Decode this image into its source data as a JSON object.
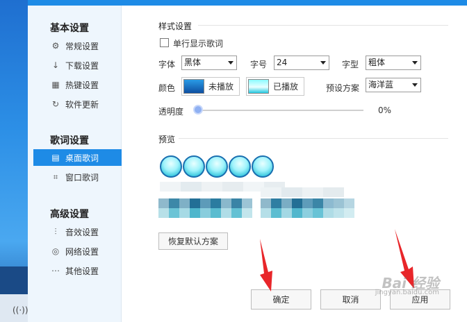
{
  "sidebar": {
    "group_basic": "基本设置",
    "basic_items": [
      {
        "label": "常规设置",
        "icon": "gear-icon",
        "glyph": "⚙"
      },
      {
        "label": "下载设置",
        "icon": "download-icon",
        "glyph": "↓"
      },
      {
        "label": "热键设置",
        "icon": "keyboard-icon",
        "glyph": "▦"
      },
      {
        "label": "软件更新",
        "icon": "refresh-icon",
        "glyph": "↻"
      }
    ],
    "group_lyrics": "歌词设置",
    "lyrics_items": [
      {
        "label": "桌面歌词",
        "icon": "desktop-lyrics-icon",
        "glyph": "▤",
        "active": true
      },
      {
        "label": "窗口歌词",
        "icon": "window-lyrics-icon",
        "glyph": "⌗",
        "active": false
      }
    ],
    "group_advanced": "高级设置",
    "advanced_items": [
      {
        "label": "音效设置",
        "icon": "equalizer-icon",
        "glyph": "⫶"
      },
      {
        "label": "网络设置",
        "icon": "network-icon",
        "glyph": "◎"
      },
      {
        "label": "其他设置",
        "icon": "more-icon",
        "glyph": "⋯"
      }
    ]
  },
  "style": {
    "title": "样式设置",
    "single_line_label": "单行显示歌词",
    "single_line_checked": false,
    "font_label": "字体",
    "font_value": "黑体",
    "size_label": "字号",
    "size_value": "24",
    "weight_label": "字型",
    "weight_value": "粗体",
    "color_label": "颜色",
    "unplayed_label": "未播放",
    "played_label": "已播放",
    "preset_label": "预设方案",
    "preset_value": "海洋蓝",
    "opacity_label": "透明度",
    "opacity_value": "0%",
    "opacity_fraction": 0.0
  },
  "preview": {
    "title": "预览",
    "reset_button": "恢复默认方案"
  },
  "footer": {
    "ok_button": "确定",
    "cancel_button": "取消",
    "apply_button": "应用"
  },
  "colors": {
    "accent": "#1e8be6",
    "annotation_arrow": "#e8262a"
  },
  "watermark": {
    "text": "Bai 经验",
    "sub": "jingyan.baidu.com"
  },
  "desktop": {
    "tray_icon": "network-tray-icon"
  }
}
